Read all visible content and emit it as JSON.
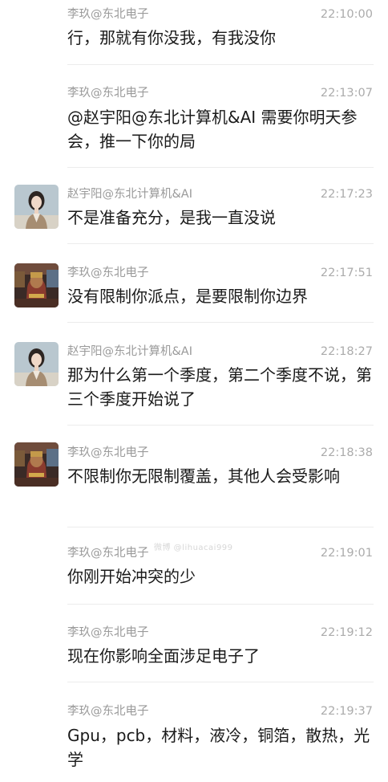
{
  "messages": [
    {
      "sender": "李玖@东北电子",
      "time": "22:10:00",
      "text": "行，那就有你没我，有我没你",
      "avatar": "none"
    },
    {
      "sender": "李玖@东北电子",
      "time": "22:13:07",
      "text": "@赵宇阳@东北计算机&AI 需要你明天参会，推一下你的局",
      "avatar": "none"
    },
    {
      "sender": "赵宇阳@东北计算机&AI",
      "time": "22:17:23",
      "text": "不是准备充分，是我一直没说",
      "avatar": "woman-portrait"
    },
    {
      "sender": "李玖@东北电子",
      "time": "22:17:51",
      "text": "没有限制你派点，是要限制你边界",
      "avatar": "statue-figure"
    },
    {
      "sender": "赵宇阳@东北计算机&AI",
      "time": "22:18:27",
      "text": "那为什么第一个季度，第二个季度不说，第三个季度开始说了",
      "avatar": "woman-portrait"
    },
    {
      "sender": "李玖@东北电子",
      "time": "22:18:38",
      "text": "不限制你无限制覆盖，其他人会受影响",
      "avatar": "statue-figure"
    },
    {
      "sender": "李玖@东北电子",
      "time": "22:19:01",
      "text": "你刚开始冲突的少",
      "avatar": "none"
    },
    {
      "sender": "李玖@东北电子",
      "time": "22:19:12",
      "text": "现在你影响全面涉足电子了",
      "avatar": "none"
    },
    {
      "sender": "李玖@东北电子",
      "time": "22:19:37",
      "text": "Gpu，pcb，材料，液冷，铜箔，散热，光学",
      "avatar": "none"
    }
  ],
  "watermark": "微博 @lihuacai999"
}
